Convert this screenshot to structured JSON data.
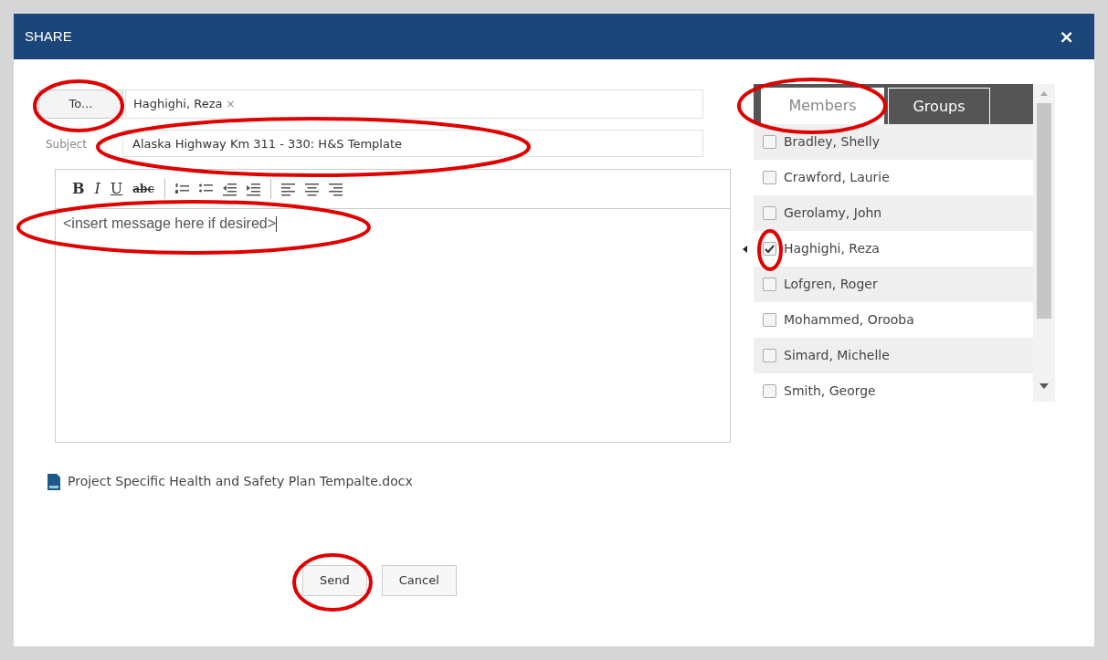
{
  "dialog": {
    "title": "SHARE",
    "close": "×"
  },
  "to_button": {
    "label": "To...",
    "highlighted": true
  },
  "recipients": [
    {
      "name": "Haghighi, Reza",
      "remove": "×"
    }
  ],
  "subject": {
    "label": "Subject",
    "value": "Alaska Highway Km 311 - 330: H&S Template",
    "highlighted": true
  },
  "toolbar": [
    {
      "kind": "text",
      "label": "B"
    },
    {
      "kind": "text",
      "label": "I"
    },
    {
      "kind": "text",
      "label": "U"
    },
    {
      "kind": "text",
      "label": "abc"
    },
    {
      "kind": "separator"
    },
    {
      "kind": "numbered-list"
    },
    {
      "kind": "bullet-list"
    },
    {
      "kind": "outdent"
    },
    {
      "kind": "indent"
    },
    {
      "kind": "separator"
    },
    {
      "kind": "align-left"
    },
    {
      "kind": "align-center"
    },
    {
      "kind": "align-right"
    }
  ],
  "message": {
    "value": "<insert message here if desired>",
    "highlighted": true
  },
  "tabs": [
    {
      "label": "Members",
      "selected": true,
      "highlighted": true
    },
    {
      "label": "Groups",
      "selected": false,
      "highlighted": false
    }
  ],
  "members": [
    {
      "name": "Bradley, Shelly",
      "checked": false,
      "selected": false,
      "highlighted": false
    },
    {
      "name": "Crawford, Laurie",
      "checked": false,
      "selected": false,
      "highlighted": false
    },
    {
      "name": "Gerolamy, John",
      "checked": false,
      "selected": false,
      "highlighted": false
    },
    {
      "name": "Haghighi, Reza",
      "checked": true,
      "selected": true,
      "highlighted": true
    },
    {
      "name": "Lofgren, Roger",
      "checked": false,
      "selected": false,
      "highlighted": false
    },
    {
      "name": "Mohammed, Orooba",
      "checked": false,
      "selected": false,
      "highlighted": false
    },
    {
      "name": "Simard, Michelle",
      "checked": false,
      "selected": false,
      "highlighted": false
    },
    {
      "name": "Smith, George",
      "checked": false,
      "selected": false,
      "highlighted": false
    }
  ],
  "attachment": {
    "name": "Project Specific Health and Safety Plan Tempalte.docx"
  },
  "buttons": [
    {
      "label": "Send",
      "highlighted": true
    },
    {
      "label": "Cancel",
      "highlighted": false
    }
  ]
}
